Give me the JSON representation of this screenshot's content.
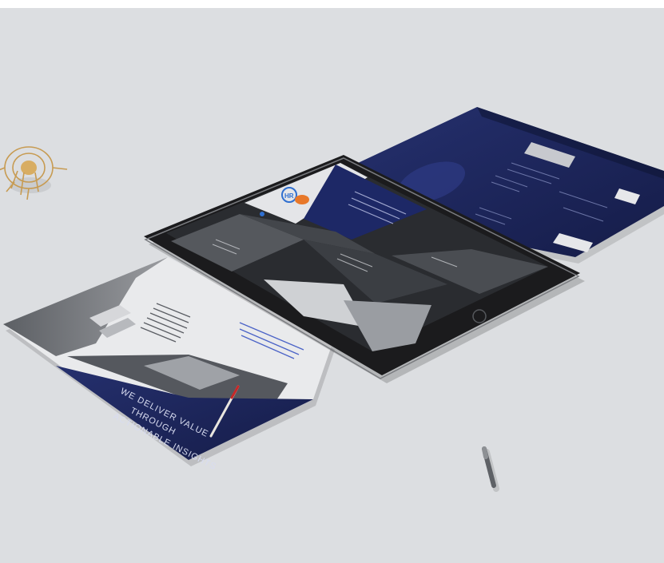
{
  "scene": {
    "description_free": true,
    "colors": {
      "background": "#dcdee1",
      "navy": "#1c2763",
      "navy_dark": "#141b47",
      "tablet_frame": "#1b1b1d",
      "paper_gray": "#8a8c90",
      "photo_dark": "#3e4146",
      "photo_light": "#c9cbce",
      "accent_orange": "#e8782a",
      "accent_blue": "#2f6fd0",
      "pencil_red": "#c62828"
    },
    "icons": [
      "wooden-spiral-ornament",
      "pen-cap",
      "pencil",
      "logo-badge"
    ]
  },
  "brochure": {
    "headline_lines": [
      "WE DELIVER VALUE",
      "THROUGH",
      "ACTIONABLE INSIGHTS"
    ]
  },
  "tablet": {
    "logo_text": "HR"
  }
}
